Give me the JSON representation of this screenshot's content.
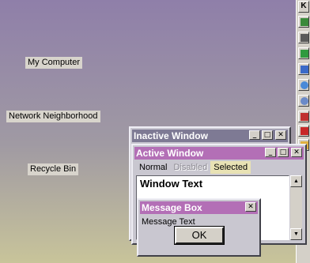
{
  "desktop": {
    "icons": [
      {
        "label": "My Computer"
      },
      {
        "label": "Network Neighborhood"
      },
      {
        "label": "Recycle Bin"
      }
    ]
  },
  "taskbar": {
    "top_label": "K",
    "icons": [
      "monitor-icon",
      "pen-icon",
      "book-icon",
      "image-icon",
      "globe-icon",
      "disc-icon",
      "terminal-icon",
      "paint-icon",
      "pencil-icon"
    ]
  },
  "inactive_window": {
    "title": "Inactive Window",
    "minimize": "_",
    "maximize": "□",
    "close": "✕",
    "titlebar_color": "#7e7a94"
  },
  "active_window": {
    "title": "Active Window",
    "minimize": "_",
    "maximize": "□",
    "close": "✕",
    "titlebar_color": "#b36fb6",
    "menu": {
      "normal": "Normal",
      "disabled": "Disabled",
      "selected": "Selected"
    },
    "text": "Window Text",
    "scroll_up": "▲",
    "scroll_down": "▼"
  },
  "message_box": {
    "title": "Message Box",
    "close": "✕",
    "message": "Message Text",
    "ok_label": "OK",
    "titlebar_color": "#b36fb6"
  }
}
